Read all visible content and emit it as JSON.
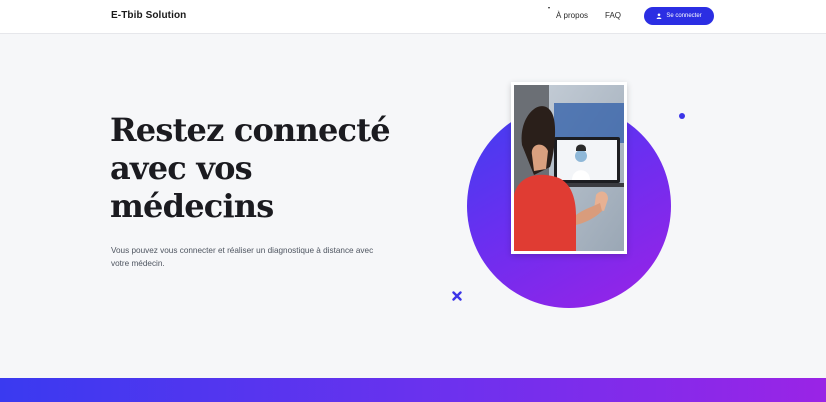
{
  "navbar": {
    "brand": "E-Tbib Solution",
    "links": [
      "À propos",
      "FAQ"
    ],
    "login_label": "Se connecter"
  },
  "hero": {
    "title_lines": [
      "Restez connecté",
      "avec vos",
      "médecins"
    ],
    "subtitle": "Vous pouvez vous connecter et réaliser un diagnostique à distance avec votre médecin."
  },
  "colors": {
    "accent": "#2b2ee3",
    "gradient_start": "#3f3ff0",
    "gradient_end": "#9b22e6",
    "background": "#f6f7f9"
  },
  "icons": {
    "login": "user-icon",
    "decor_cross": "cross-icon",
    "decor_dot": "dot-icon"
  }
}
